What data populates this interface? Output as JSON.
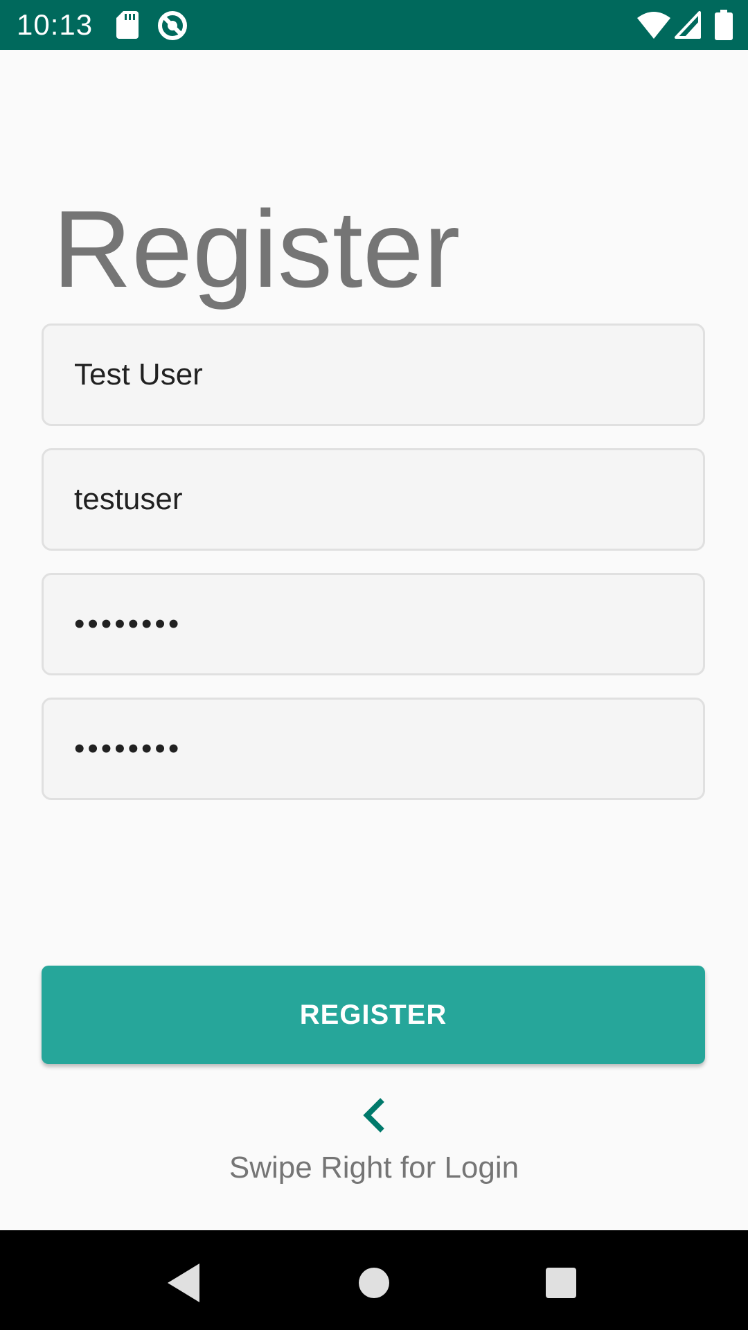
{
  "status_bar": {
    "time": "10:13",
    "icons": [
      "sd-card-icon",
      "sync-blocked-icon",
      "wifi-icon",
      "cell-signal-icon",
      "battery-icon"
    ],
    "background_color": "#00695c"
  },
  "register_form": {
    "title": "Register",
    "fields": [
      {
        "name": "full-name-field",
        "value": "Test User",
        "type": "text"
      },
      {
        "name": "username-field",
        "value": "testuser",
        "type": "text"
      },
      {
        "name": "password-field",
        "value": "passw0rd",
        "type": "password"
      },
      {
        "name": "confirm-password-field",
        "value": "passw0rd",
        "type": "password"
      }
    ],
    "register_button_label": "REGISTER",
    "accent_color": "#26a69a"
  },
  "swipe_hint": {
    "icon": "chevron-left-icon",
    "text": "Swipe Right for Login"
  },
  "nav_bar": {
    "buttons": [
      "back-icon",
      "home-icon",
      "recents-icon"
    ]
  }
}
